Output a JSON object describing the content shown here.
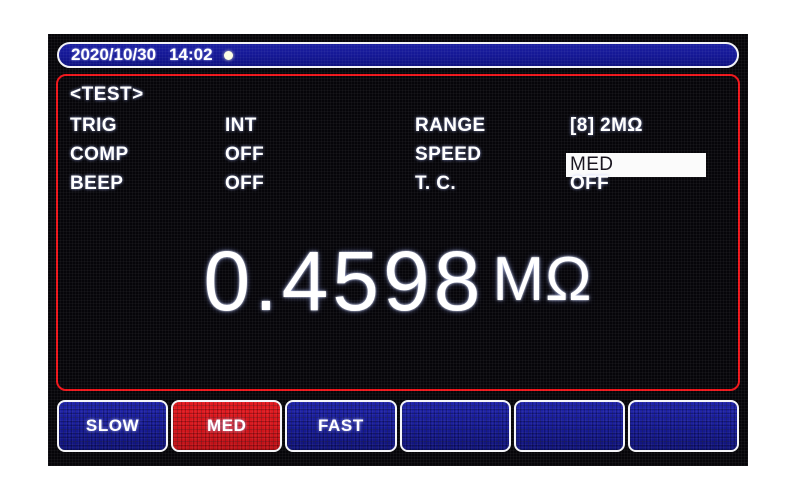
{
  "colors": {
    "screen_background": "#060509",
    "panel_border_red": "#ee1318",
    "softkey_blue": "#161a93",
    "softkey_active_red": "#d3151b",
    "text_white": "#ffffff",
    "titlebar_blue": "#141796",
    "highlight_white": "#fbfbfb",
    "status_dot": "#fdfde4"
  },
  "title_bar": {
    "date": "2020/10/30",
    "time": "14:02",
    "status_dot_name": "recording-indicator-dot"
  },
  "main_panel": {
    "mode_label": "<TEST>",
    "parameters": [
      {
        "left_label": "TRIG",
        "left_value": "INT",
        "left_highlighted": false,
        "right_label": "RANGE",
        "right_value": "[8] 2MΩ",
        "right_highlighted": false
      },
      {
        "left_label": "COMP",
        "left_value": "OFF",
        "left_highlighted": false,
        "right_label": "SPEED",
        "right_value": "MED",
        "right_highlighted": true
      },
      {
        "left_label": "BEEP",
        "left_value": "OFF",
        "left_highlighted": false,
        "right_label": "T. C.",
        "right_value": "OFF",
        "right_highlighted": false
      }
    ],
    "reading": {
      "value": "0.4598",
      "unit": "MΩ"
    }
  },
  "softkeys": [
    {
      "label": "SLOW",
      "active": false
    },
    {
      "label": "MED",
      "active": true
    },
    {
      "label": "FAST",
      "active": false
    },
    {
      "label": "",
      "active": false
    },
    {
      "label": "",
      "active": false
    },
    {
      "label": "",
      "active": false
    }
  ]
}
